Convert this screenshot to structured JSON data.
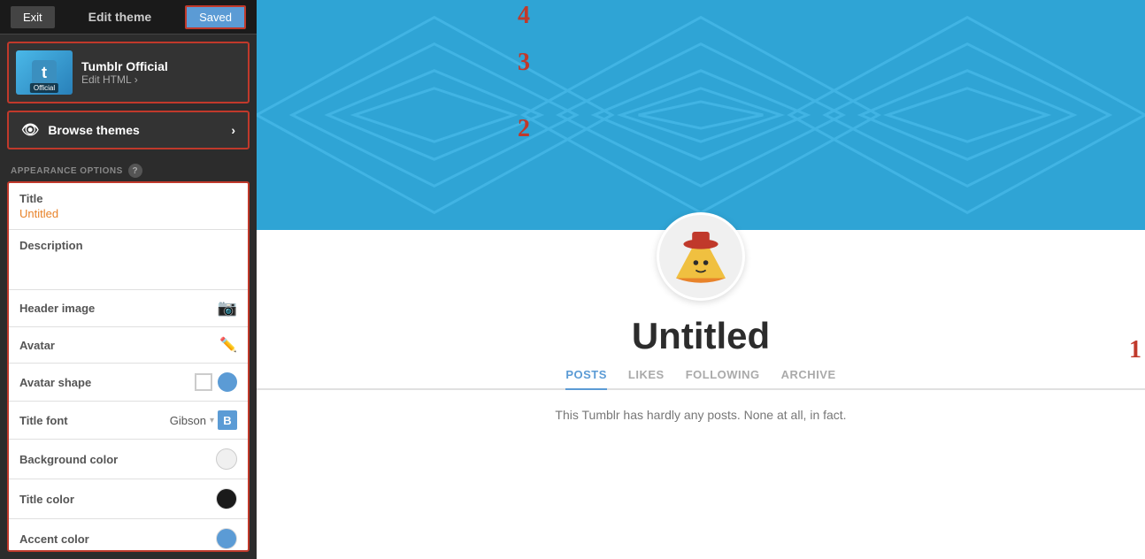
{
  "header": {
    "exit_label": "Exit",
    "title": "Edit theme",
    "saved_label": "Saved"
  },
  "theme": {
    "name": "Tumblr Official",
    "edit_html_label": "Edit HTML",
    "badge": "Official"
  },
  "browse_themes": {
    "label": "Browse themes"
  },
  "appearance": {
    "section_label": "APPEARANCE OPTIONS",
    "help_label": "?",
    "title_label": "Title",
    "title_value": "Untitled",
    "description_label": "Description",
    "description_placeholder": "",
    "header_image_label": "Header image",
    "avatar_label": "Avatar",
    "avatar_shape_label": "Avatar shape",
    "title_font_label": "Title font",
    "title_font_value": "Gibson",
    "background_color_label": "Background color",
    "title_color_label": "Title color",
    "accent_color_label": "Accent color"
  },
  "preview": {
    "blog_title": "Untitled",
    "tabs": [
      "POSTS",
      "LIKES",
      "FOLLOWING",
      "ARCHIVE"
    ],
    "active_tab": "POSTS",
    "description": "This Tumblr has hardly any posts. None at all, in fact."
  },
  "annotations": {
    "a1": "1",
    "a2": "2",
    "a3": "3",
    "a4": "4"
  }
}
